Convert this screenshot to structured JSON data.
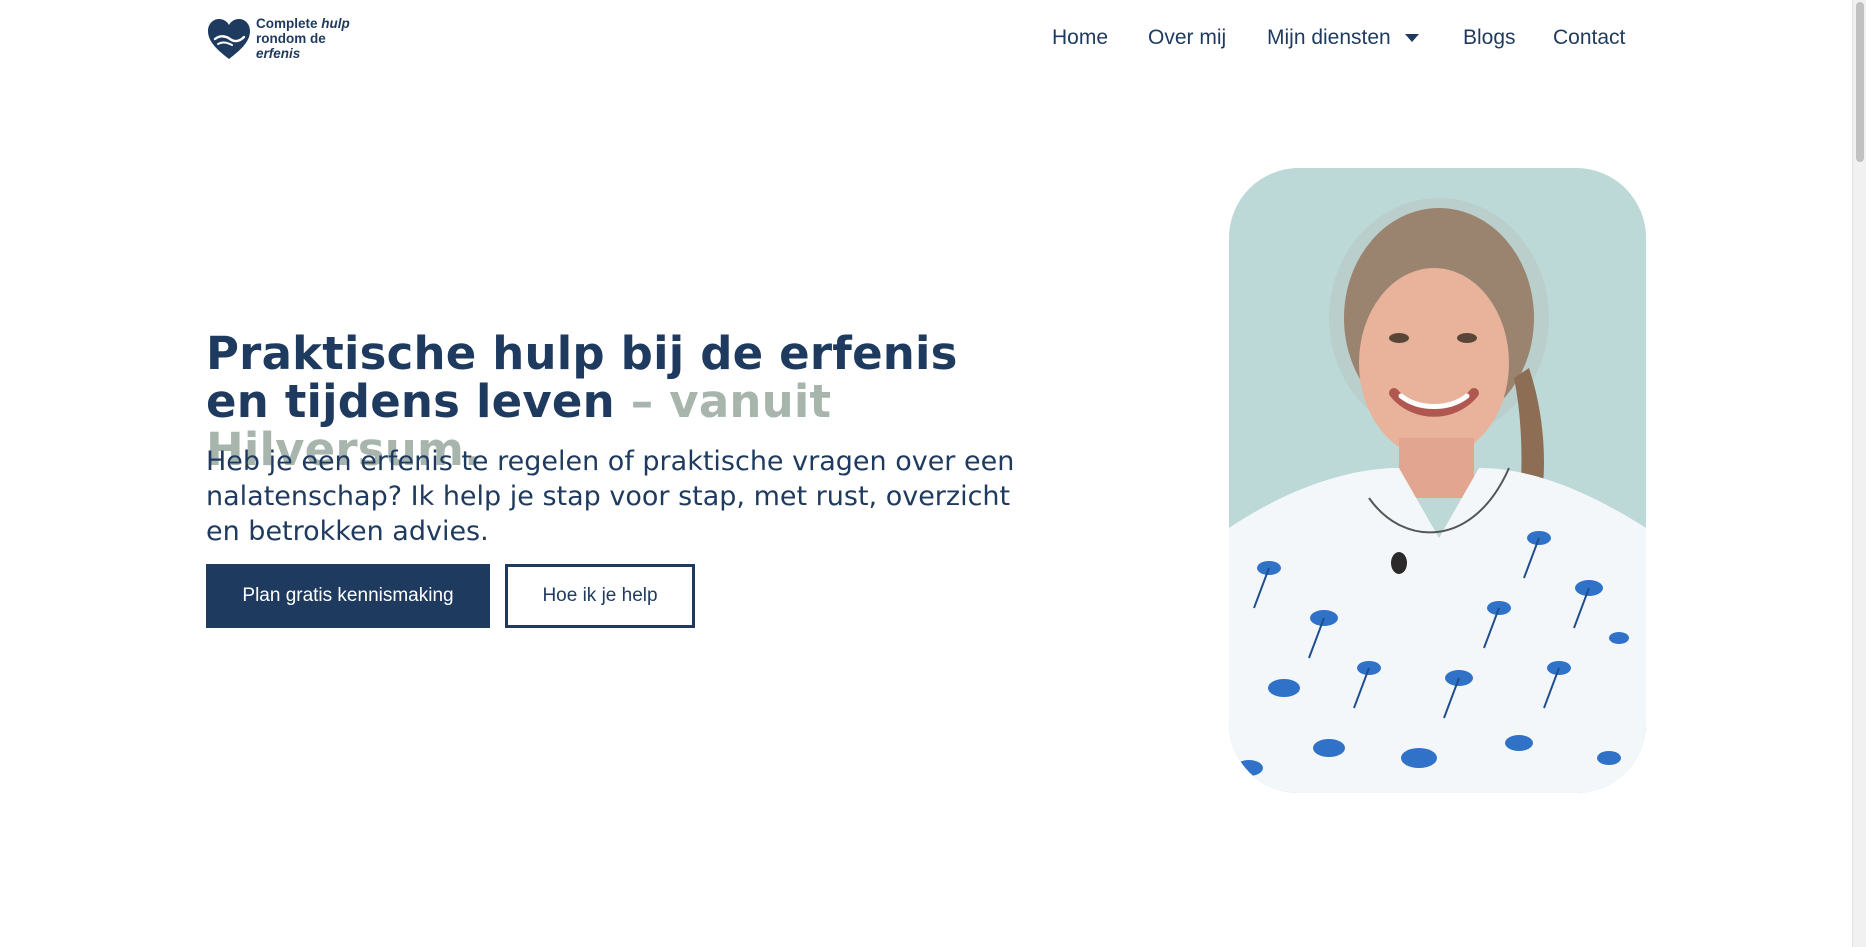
{
  "logo": {
    "line1": "Complete",
    "line1_em": "hulp",
    "line2": "rondom de",
    "line3": "erfenis",
    "icon": "heart-hands-icon"
  },
  "nav": {
    "home": "Home",
    "over": "Over mij",
    "diensten": "Mijn diensten",
    "blogs": "Blogs",
    "contact": "Contact"
  },
  "hero": {
    "title_main": "Praktische hulp bij de erfenis en tijdens leven",
    "title_accent": "– vanuit Hilversum.",
    "subtitle": "Heb je een erfenis te regelen of praktische vragen over een nalatenschap? Ik help je stap voor stap, met rust, overzicht en betrokken advies.",
    "primary_button": "Plan gratis kennismaking",
    "secondary_button": "Hoe ik je help"
  },
  "colors": {
    "brand": "#1f3a5f",
    "accent": "#a7b5ad",
    "background": "#ffffff"
  }
}
